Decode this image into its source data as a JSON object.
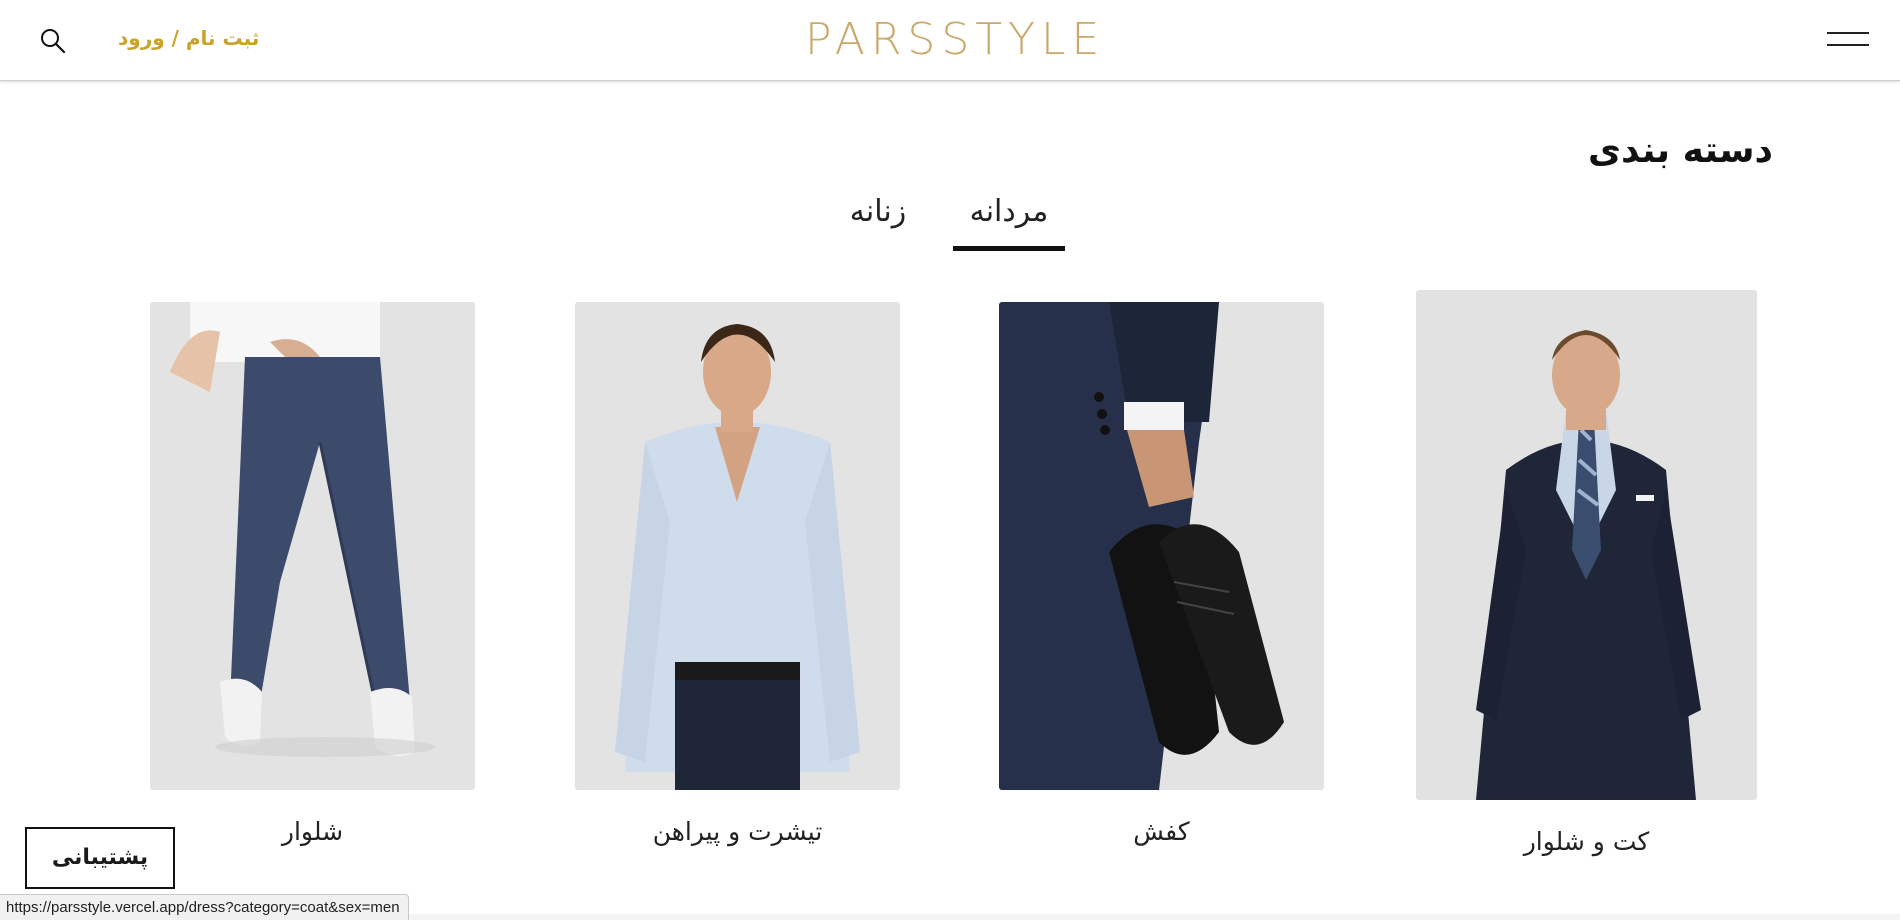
{
  "header": {
    "logo": "PARSSTYLE",
    "auth_link": "ثبت نام / ورود",
    "search_icon": "search-icon",
    "menu_icon": "hamburger-menu-icon"
  },
  "section": {
    "title": "دسته بندی"
  },
  "tabs": [
    {
      "label": "مردانه",
      "active": true
    },
    {
      "label": "زنانه",
      "active": false
    }
  ],
  "categories": [
    {
      "label": "کت و شلوار",
      "image": "man-in-navy-suit"
    },
    {
      "label": "کفش",
      "image": "hand-holding-black-oxford-shoes"
    },
    {
      "label": "تیشرت و پیراهن",
      "image": "man-in-light-blue-shirt"
    },
    {
      "label": "شلوار",
      "image": "legs-in-blue-jeans-white-sneakers"
    }
  ],
  "back_button": {
    "label": "پشتیبانی"
  },
  "status_bar": {
    "url": "https://parsstyle.vercel.app/dress?category=coat&sex=men"
  },
  "colors": {
    "accent_gold": "#c9a227",
    "logo_gold": "#c9a86a",
    "card_bg": "#e3e3e3",
    "text_dark": "#111111"
  }
}
